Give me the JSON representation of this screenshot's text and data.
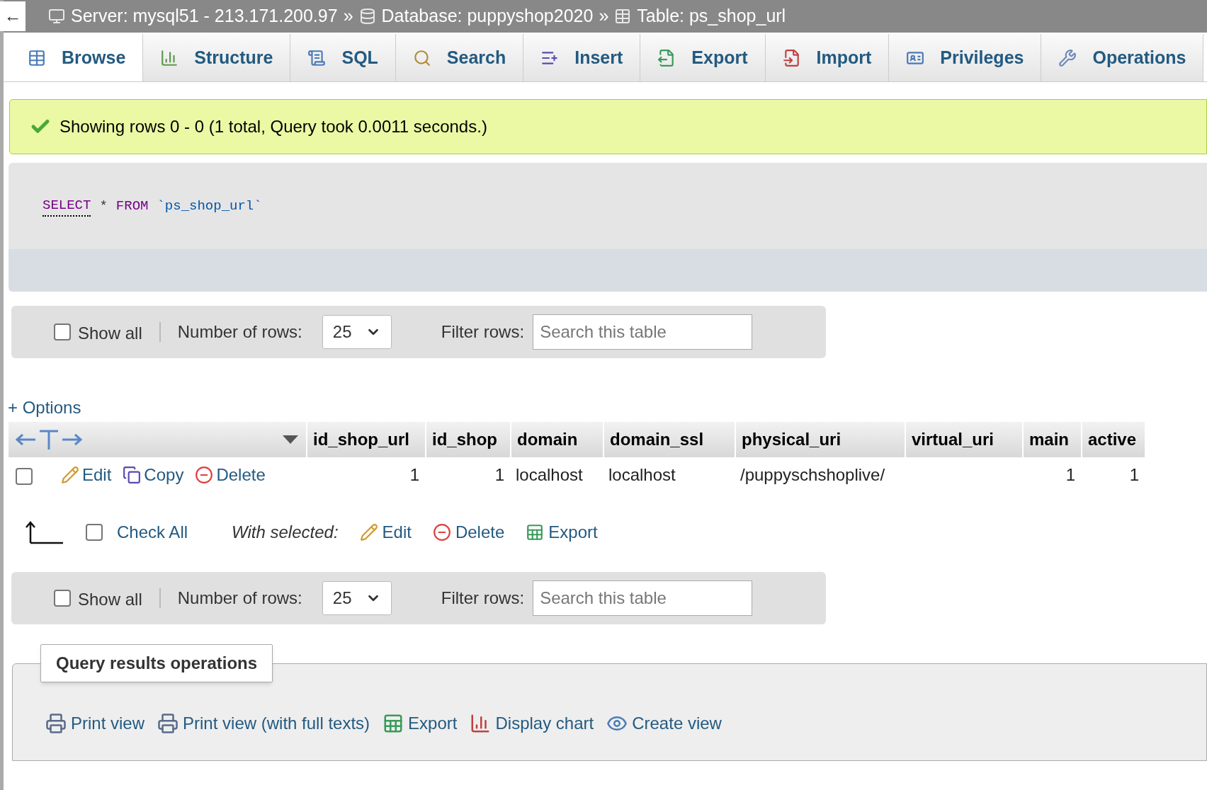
{
  "breadcrumb": {
    "back": "←",
    "items": [
      {
        "kind": "server",
        "label": "Server: mysql51 - 213.171.200.97"
      },
      {
        "kind": "database",
        "label": "Database: puppyshop2020"
      },
      {
        "kind": "table",
        "label": "Table: ps_shop_url"
      }
    ],
    "separator": "»"
  },
  "tabs": [
    {
      "kind": "browse",
      "label": "Browse",
      "selected": true
    },
    {
      "kind": "structure",
      "label": "Structure",
      "selected": false
    },
    {
      "kind": "sql",
      "label": "SQL",
      "selected": false
    },
    {
      "kind": "search",
      "label": "Search",
      "selected": false
    },
    {
      "kind": "insert",
      "label": "Insert",
      "selected": false
    },
    {
      "kind": "export",
      "label": "Export",
      "selected": false
    },
    {
      "kind": "import",
      "label": "Import",
      "selected": false
    },
    {
      "kind": "privileges",
      "label": "Privileges",
      "selected": false
    },
    {
      "kind": "operations",
      "label": "Operations",
      "selected": false
    }
  ],
  "message": "Showing rows 0 - 0 (1 total, Query took 0.0011 seconds.)",
  "query": {
    "keyword1": "SELECT",
    "star": "*",
    "keyword2": "FROM",
    "table": "`ps_shop_url`"
  },
  "navbars": [
    {
      "show_all": {
        "label": "Show all",
        "checked": false
      },
      "rows_label": "Number of rows:",
      "rows_value": "25",
      "filter_label": "Filter rows:",
      "filter_placeholder": "Search this table"
    },
    {
      "show_all": {
        "label": "Show all",
        "checked": false
      },
      "rows_label": "Number of rows:",
      "rows_value": "25",
      "filter_label": "Filter rows:",
      "filter_placeholder": "Search this table"
    }
  ],
  "options_link": "+ Options",
  "table": {
    "columns": [
      {
        "label": "id_shop_url",
        "kind": "number"
      },
      {
        "label": "id_shop",
        "kind": "number"
      },
      {
        "label": "domain",
        "kind": "text"
      },
      {
        "label": "domain_ssl",
        "kind": "text"
      },
      {
        "label": "physical_uri",
        "kind": "text"
      },
      {
        "label": "virtual_uri"
      },
      {
        "label": "main",
        "kind": "number"
      },
      {
        "label": "active",
        "kind": "number"
      }
    ],
    "rows": [
      {
        "checked": false,
        "actions": [
          {
            "kind": "edit",
            "label": "Edit"
          },
          {
            "kind": "copy",
            "label": "Copy"
          },
          {
            "kind": "delete",
            "label": "Delete"
          }
        ],
        "cells": [
          "1",
          "1",
          "localhost",
          "localhost",
          "/puppyschshoplive/",
          null,
          "1",
          "1"
        ]
      }
    ]
  },
  "bulk": {
    "check_all": {
      "label": "Check All",
      "checked": false
    },
    "with_selected": "With selected:",
    "actions": [
      {
        "kind": "edit",
        "label": "Edit"
      },
      {
        "kind": "delete",
        "label": "Delete"
      },
      {
        "kind": "export",
        "label": "Export"
      }
    ]
  },
  "operations": {
    "legend": "Query results operations",
    "links": [
      {
        "kind": "print",
        "label": "Print view"
      },
      {
        "kind": "print",
        "label": "Print view (with full texts)"
      },
      {
        "kind": "export",
        "label": "Export"
      },
      {
        "kind": "chart",
        "label": "Display chart"
      },
      {
        "kind": "view",
        "label": "Create view"
      }
    ]
  }
}
